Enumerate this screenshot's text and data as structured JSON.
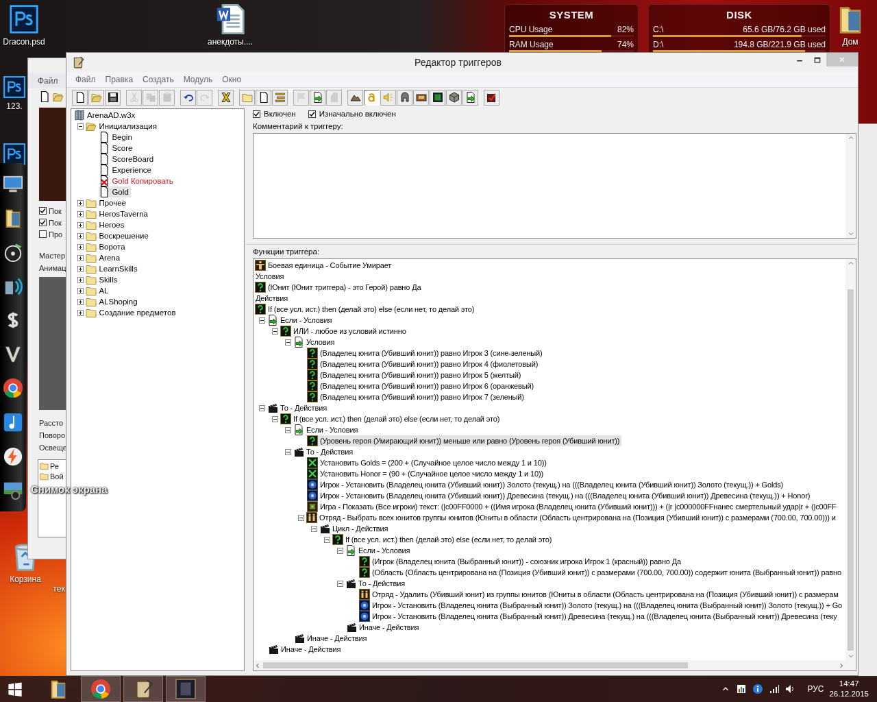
{
  "desktop": {
    "icons": [
      {
        "kind": "psd",
        "label": "Dracon.psd"
      },
      {
        "kind": "psd",
        "label": "123."
      },
      {
        "kind": "psd"
      },
      {
        "kind": "word",
        "label": "анекдоты...."
      },
      {
        "kind": "folder",
        "label": "Дом"
      },
      {
        "kind": "trash",
        "label": "Корзина"
      },
      {
        "kind": "hidden",
        "label": "тек"
      }
    ],
    "dock_tooltip": "Снимок экрана"
  },
  "widgets": [
    {
      "title": "SYSTEM",
      "rows": [
        {
          "label": "CPU Usage",
          "value": "82%",
          "level": 0.82
        },
        {
          "label": "RAM Usage",
          "value": "74%",
          "level": 0.74
        }
      ]
    },
    {
      "title": "DISK",
      "rows": [
        {
          "label": "C:\\",
          "value": "65.6 GB/76.2 GB used",
          "level": 0.86
        },
        {
          "label": "D:\\",
          "value": "194.8 GB/221.9 GB used",
          "level": 0.88
        }
      ]
    }
  ],
  "background_window": {
    "menu": [
      "Файл"
    ],
    "checks": [
      {
        "label": "Пок",
        "checked": true
      },
      {
        "label": "Пок",
        "checked": true
      },
      {
        "label": "Про",
        "checked": false
      }
    ],
    "labels_top": [
      "Мастер",
      "Анимац"
    ],
    "labels_bottom": [
      "Рассто",
      "Поворо",
      "Освеще"
    ],
    "folders": [
      "Ре",
      "Вой"
    ]
  },
  "editor": {
    "title": "Редактор триггеров",
    "menu": [
      "Файл",
      "Правка",
      "Создать",
      "Модуль",
      "Окно"
    ],
    "toolbar": [
      [
        {
          "kind": "new",
          "disabled": false
        },
        {
          "kind": "open",
          "disabled": false
        },
        {
          "kind": "save",
          "disabled": false
        }
      ],
      [
        {
          "kind": "cut",
          "disabled": true
        },
        {
          "kind": "copy",
          "disabled": true
        },
        {
          "kind": "paste",
          "disabled": true
        }
      ],
      [
        {
          "kind": "undo",
          "disabled": false
        },
        {
          "kind": "redo",
          "disabled": true
        }
      ],
      [
        {
          "kind": "x-tool",
          "disabled": false
        }
      ],
      [
        {
          "kind": "new-category",
          "disabled": false
        },
        {
          "kind": "new-trigger",
          "disabled": false
        },
        {
          "kind": "new-comment",
          "disabled": false
        }
      ],
      [
        {
          "kind": "new-event",
          "disabled": true
        },
        {
          "kind": "new-condition",
          "disabled": false
        },
        {
          "kind": "new-action",
          "disabled": true
        }
      ]
    ],
    "modules": [
      {
        "kind": "terrain",
        "pressed": false
      },
      {
        "kind": "trigger",
        "pressed": true
      },
      {
        "kind": "sound",
        "pressed": false
      },
      {
        "kind": "object",
        "pressed": false
      },
      {
        "kind": "campaign",
        "pressed": false
      },
      {
        "kind": "ai",
        "pressed": false
      },
      {
        "kind": "object-box",
        "pressed": false
      },
      {
        "kind": "import",
        "pressed": false
      }
    ],
    "test_button": {
      "kind": "test-map"
    },
    "trigger_list": [
      {
        "kind": "map",
        "label": "ArenaAD.w3x",
        "selected": false,
        "children": [
          {
            "kind": "folder",
            "label": "Инициализация",
            "selected": false,
            "expanded": true,
            "children": [
              {
                "kind": "trigger",
                "label": "Begin",
                "selected": false,
                "disabled": false
              },
              {
                "kind": "trigger",
                "label": "Score",
                "selected": false,
                "disabled": false
              },
              {
                "kind": "trigger",
                "label": "ScoreBoard",
                "selected": false,
                "disabled": false
              },
              {
                "kind": "trigger",
                "label": "Experience",
                "selected": false,
                "disabled": false
              },
              {
                "kind": "trigger",
                "label": "Gold Копировать",
                "selected": false,
                "disabled": true
              },
              {
                "kind": "trigger",
                "label": "Gold",
                "selected": true,
                "disabled": false
              }
            ]
          },
          {
            "kind": "folder",
            "label": "Прочее",
            "selected": false,
            "expanded": false
          },
          {
            "kind": "folder",
            "label": "HerosTaverna",
            "selected": false,
            "expanded": false
          },
          {
            "kind": "folder",
            "label": "Heroes",
            "selected": false,
            "expanded": false
          },
          {
            "kind": "folder",
            "label": "Воскрешение",
            "selected": false,
            "expanded": false
          },
          {
            "kind": "folder",
            "label": "Ворота",
            "selected": false,
            "expanded": false
          },
          {
            "kind": "folder",
            "label": "Arena",
            "selected": false,
            "expanded": false
          },
          {
            "kind": "folder",
            "label": "LearnSkills",
            "selected": false,
            "expanded": false
          },
          {
            "kind": "folder",
            "label": "Skills",
            "selected": false,
            "expanded": false
          },
          {
            "kind": "folder",
            "label": "AL",
            "selected": false,
            "expanded": false
          },
          {
            "kind": "folder",
            "label": "ALShoping",
            "selected": false,
            "expanded": false
          },
          {
            "kind": "folder",
            "label": "Создание предметов",
            "selected": false,
            "expanded": false
          }
        ]
      }
    ],
    "trigger": {
      "options": [
        {
          "label": "Включен",
          "checked": true
        },
        {
          "label": "Изначально включен",
          "checked": true
        }
      ],
      "comment_label": "Комментарий к триггеру:",
      "functions_label": "Функции триггера:",
      "functions": [
        {
          "kind": "event",
          "text": "Боевая единица - Событие Умирает",
          "selected": false
        },
        {
          "kind": "header",
          "text": "Условия",
          "selected": false
        },
        {
          "kind": "condition",
          "text": "(Юнит (Юнит триггера) - это Герой) равно Да",
          "selected": false
        },
        {
          "kind": "header",
          "text": "Действия",
          "selected": false
        },
        {
          "kind": "condition",
          "text": "If (все усл. ист.) then (делай это) else (если нет, то делай это)",
          "selected": false,
          "children": [
            {
              "kind": "if-block",
              "text": "Если - Условия",
              "selected": false,
              "expanded": true,
              "children": [
                {
                  "kind": "condition",
                  "text": "ИЛИ - любое из условий истинно",
                  "selected": false,
                  "expanded": true,
                  "children": [
                    {
                      "kind": "if-block",
                      "text": "Условия",
                      "selected": false,
                      "expanded": true,
                      "children": [
                        {
                          "kind": "condition",
                          "text": "(Владелец юнита (Убивший юнит)) равно Игрок 3 (сине-зеленый)",
                          "selected": false
                        },
                        {
                          "kind": "condition",
                          "text": "(Владелец юнита (Убивший юнит)) равно Игрок 4 (фиолетовый)",
                          "selected": false
                        },
                        {
                          "kind": "condition",
                          "text": "(Владелец юнита (Убивший юнит)) равно Игрок 5 (желтый)",
                          "selected": false
                        },
                        {
                          "kind": "condition",
                          "text": "(Владелец юнита (Убивший юнит)) равно Игрок 6 (оранжевый)",
                          "selected": false
                        },
                        {
                          "kind": "condition",
                          "text": "(Владелец юнита (Убивший юнит)) равно Игрок 7 (зеленый)",
                          "selected": false
                        }
                      ]
                    }
                  ]
                }
              ]
            },
            {
              "kind": "then-block",
              "text": "То - Действия",
              "selected": false,
              "expanded": true,
              "children": [
                {
                  "kind": "condition",
                  "text": "If (все усл. ист.) then (делай это) else (если нет, то делай это)",
                  "selected": false,
                  "expanded": true,
                  "children": [
                    {
                      "kind": "if-block",
                      "text": "Если - Условия",
                      "selected": false,
                      "expanded": true,
                      "children": [
                        {
                          "kind": "condition",
                          "text": "(Уровень героя (Умирающий юнит)) меньше или равно (Уровень героя (Убивший юнит))",
                          "selected": true
                        }
                      ]
                    },
                    {
                      "kind": "then-block",
                      "text": "То - Действия",
                      "selected": false,
                      "expanded": true,
                      "children": [
                        {
                          "kind": "set-variable",
                          "text": "Установить Golds = (200 + (Случайное целое число между 1 и 10))",
                          "selected": false
                        },
                        {
                          "kind": "set-variable",
                          "text": "Установить Honor = (90 + (Случайное целое число между 1 и 10))",
                          "selected": false
                        },
                        {
                          "kind": "player",
                          "text": "Игрок - Установить (Владелец юнита (Убивший юнит)) Золото (текущ.) на (((Владелец юнита (Убивший юнит)) Золото (текущ.)) + Golds)",
                          "selected": false
                        },
                        {
                          "kind": "player",
                          "text": "Игрок - Установить (Владелец юнита (Убивший юнит)) Древесина (текущ.) на (((Владелец юнита (Убивший юнит)) Древесина (текущ.)) + Honor)",
                          "selected": false
                        },
                        {
                          "kind": "game",
                          "text": "Игра - Показать (Все игроки) текст: (|c00FF0000 + ((Имя игрока (Владелец юнита (Убивший юнит))) + (|r |c000000FFнанес смертельный удар|r + (|c00FF",
                          "selected": false
                        },
                        {
                          "kind": "group",
                          "text": "Отряд - Выбрать всех юнитов группы юнитов (Юниты в области (Область центрирована на (Позиция (Убивший юнит)) с размерами (700.00, 700.00))) и",
                          "selected": false,
                          "expanded": true,
                          "children": [
                            {
                              "kind": "then-block",
                              "text": "Цикл - Действия",
                              "selected": false,
                              "expanded": true,
                              "children": [
                                {
                                  "kind": "condition",
                                  "text": "If (все усл. ист.) then (делай это) else (если нет, то делай это)",
                                  "selected": false,
                                  "expanded": true,
                                  "children": [
                                    {
                                      "kind": "if-block",
                                      "text": "Если - Условия",
                                      "selected": false,
                                      "expanded": true,
                                      "children": [
                                        {
                                          "kind": "condition",
                                          "text": "(Игрок (Владелец юнита (Выбранный юнит)) - союзник игрока Игрок 1 (красный)) равно Да",
                                          "selected": false
                                        },
                                        {
                                          "kind": "condition",
                                          "text": "(Область (Область центрирована на (Позиция (Убивший юнит)) с размерами (700.00, 700.00)) содержит юнита (Выбранный юнит)) равно",
                                          "selected": false
                                        }
                                      ]
                                    },
                                    {
                                      "kind": "then-block",
                                      "text": "То - Действия",
                                      "selected": false,
                                      "expanded": true,
                                      "children": [
                                        {
                                          "kind": "group",
                                          "text": "Отряд - Удалить (Убивший юнит) из группы юнитов (Юниты в области (Область центрирована на (Позиция (Убивший юнит)) с размерам",
                                          "selected": false
                                        },
                                        {
                                          "kind": "player",
                                          "text": "Игрок - Установить (Владелец юнита (Выбранный юнит)) Золото (текущ.) на (((Владелец юнита (Выбранный юнит)) Золото (текущ.)) + Go",
                                          "selected": false
                                        },
                                        {
                                          "kind": "player",
                                          "text": "Игрок - Установить (Владелец юнита (Выбранный юнит)) Древесина (текущ.) на (((Владелец юнита (Выбранный юнит)) Древесина (теку",
                                          "selected": false
                                        }
                                      ]
                                    },
                                    {
                                      "kind": "then-block",
                                      "text": "Иначе - Действия",
                                      "selected": false
                                    }
                                  ]
                                }
                              ]
                            }
                          ]
                        }
                      ]
                    },
                    {
                      "kind": "then-block",
                      "text": "Иначе - Действия",
                      "selected": false
                    }
                  ]
                }
              ]
            },
            {
              "kind": "then-block",
              "text": "Иначе - Действия",
              "selected": false
            }
          ]
        }
      ]
    }
  },
  "taskbar": {
    "items": [
      {
        "kind": "explorer",
        "open": false
      },
      {
        "kind": "browser",
        "open": true
      },
      {
        "kind": "editor",
        "open": true
      },
      {
        "kind": "game",
        "open": true
      }
    ],
    "language": "РУС",
    "time": "14:47",
    "date": "26.12.2015"
  }
}
